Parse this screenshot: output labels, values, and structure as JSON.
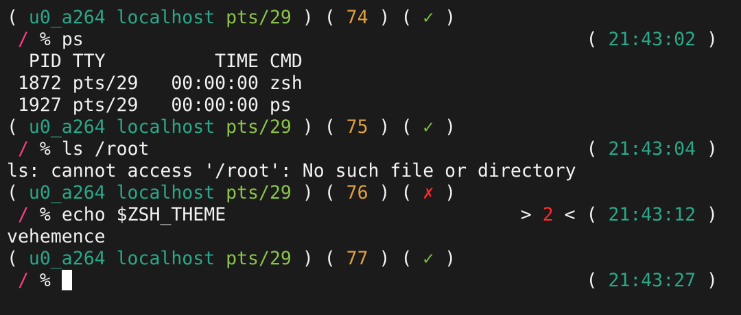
{
  "prompt_user": "u0_a264",
  "prompt_host": "localhost",
  "prompt_tty": "pts/29",
  "cwd": "/",
  "promptchar": "%",
  "ok_symbol": "✓",
  "err_symbol": "✗",
  "blocks": [
    {
      "history_num": "74",
      "status": "✓",
      "command": "ps",
      "time": "21:43:02",
      "output": [
        "  PID TTY          TIME CMD",
        " 1872 pts/29   00:00:00 zsh",
        " 1927 pts/29   00:00:00 ps"
      ]
    },
    {
      "history_num": "75",
      "status": "✓",
      "command": "ls /root",
      "time": "21:43:04",
      "output": [
        "ls: cannot access '/root': No such file or directory"
      ]
    },
    {
      "history_num": "76",
      "status": "✗",
      "command": "echo $ZSH_THEME",
      "exit_code": "2",
      "time": "21:43:12",
      "output": [
        "vehemence"
      ]
    },
    {
      "history_num": "77",
      "status": "✓",
      "command": "",
      "time": "21:43:27",
      "output": []
    }
  ]
}
